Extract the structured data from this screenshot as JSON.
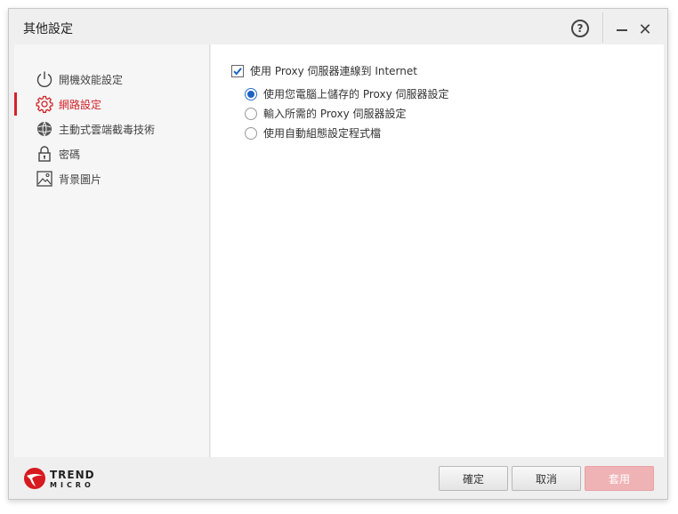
{
  "window": {
    "title": "其他設定",
    "help_symbol": "?",
    "close_symbol": "✕"
  },
  "sidebar": {
    "items": [
      {
        "label": "開機效能設定",
        "icon": "power-icon",
        "active": false
      },
      {
        "label": "網路設定",
        "icon": "gear-icon",
        "active": true
      },
      {
        "label": "主動式雲端截毒技術",
        "icon": "globe-icon",
        "active": false
      },
      {
        "label": "密碼",
        "icon": "lock-icon",
        "active": false
      },
      {
        "label": "背景圖片",
        "icon": "picture-icon",
        "active": false
      }
    ]
  },
  "settings": {
    "use_proxy": {
      "label": "使用 Proxy 伺服器連線到 Internet",
      "checked": true
    },
    "proxy_options": [
      {
        "label": "使用您電腦上儲存的 Proxy 伺服器設定",
        "selected": true
      },
      {
        "label": "輸入所需的 Proxy 伺服器設定",
        "selected": false
      },
      {
        "label": "使用自動組態設定程式檔",
        "selected": false
      }
    ]
  },
  "footer": {
    "logo": {
      "line1": "TREND",
      "line2": "MICRO"
    },
    "ok_label": "確定",
    "cancel_label": "取消",
    "apply_label": "套用",
    "apply_enabled": false
  },
  "colors": {
    "accent": "#d2232a",
    "radio_selected": "#1e63c2",
    "apply_disabled": "#f0b3b5"
  }
}
